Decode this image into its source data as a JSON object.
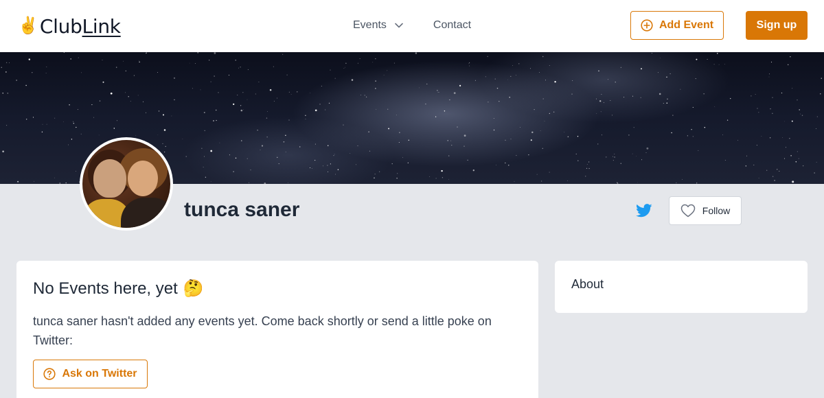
{
  "header": {
    "logo_emoji": "✌️",
    "logo_text_a": "Club",
    "logo_text_b": "Link",
    "nav": {
      "events_label": "Events",
      "contact_label": "Contact"
    },
    "add_event_label": "Add Event",
    "signup_label": "Sign up"
  },
  "profile": {
    "name": "tunca saner",
    "follow_label": "Follow"
  },
  "events_card": {
    "title": "No Events here, yet",
    "title_emoji": "🤔",
    "message": "tunca saner hasn't added any events yet. Come back shortly or send a little poke on Twitter:",
    "ask_label": "Ask on Twitter"
  },
  "about_card": {
    "title": "About"
  },
  "icons": {
    "add": "plus-circle-icon",
    "chevron": "chevron-down-icon",
    "twitter": "twitter-icon",
    "follow": "heart-icon",
    "ask": "question-circle-icon"
  },
  "colors": {
    "accent": "#d97706",
    "twitter": "#1d9bf0",
    "page_bg": "#e5e7eb"
  }
}
